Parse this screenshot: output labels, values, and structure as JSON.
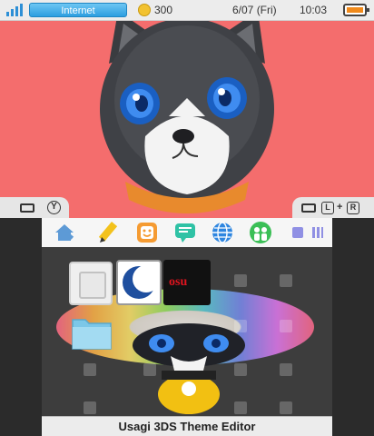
{
  "status_bar": {
    "connection": "Internet",
    "coins": "300",
    "date": "6/07 (Fri)",
    "time": "10:03",
    "signal_icon": "signal-bars-icon",
    "coin_icon": "play-coin-icon",
    "battery_icon": "battery-icon",
    "battery_color": "#f08a1b"
  },
  "top_screen": {
    "background_color": "#f46d6d",
    "wallpaper": "gray-cat-blue-eyes-orange-collar",
    "left_shortcut": {
      "icon": "camera-icon",
      "button": "Y"
    },
    "right_shortcut": {
      "icon": "camera-icon",
      "buttons": [
        "L",
        "+",
        "R"
      ]
    }
  },
  "home_toolbar": {
    "items": [
      {
        "icon": "home-settings-icon"
      },
      {
        "icon": "notes-pencil-icon"
      },
      {
        "icon": "miiverse-face-icon"
      },
      {
        "icon": "notifications-speech-icon"
      },
      {
        "icon": "internet-browser-globe-icon"
      },
      {
        "icon": "friend-list-icon"
      }
    ],
    "right_icons": [
      "zoom-out-square-icon",
      "zoom-in-grid-icon"
    ]
  },
  "home_grid": {
    "tiles": [
      {
        "name": "empty-software-tile",
        "icon": "blank-cartridge-icon"
      },
      {
        "name": "moon-app-tile",
        "icon": "crescent-moon-icon"
      },
      {
        "name": "osu-app-tile",
        "label": "osu"
      },
      {
        "name": "folder-tile",
        "icon": "folder-icon"
      }
    ]
  },
  "footer": {
    "label": "Usagi 3DS Theme Editor"
  }
}
